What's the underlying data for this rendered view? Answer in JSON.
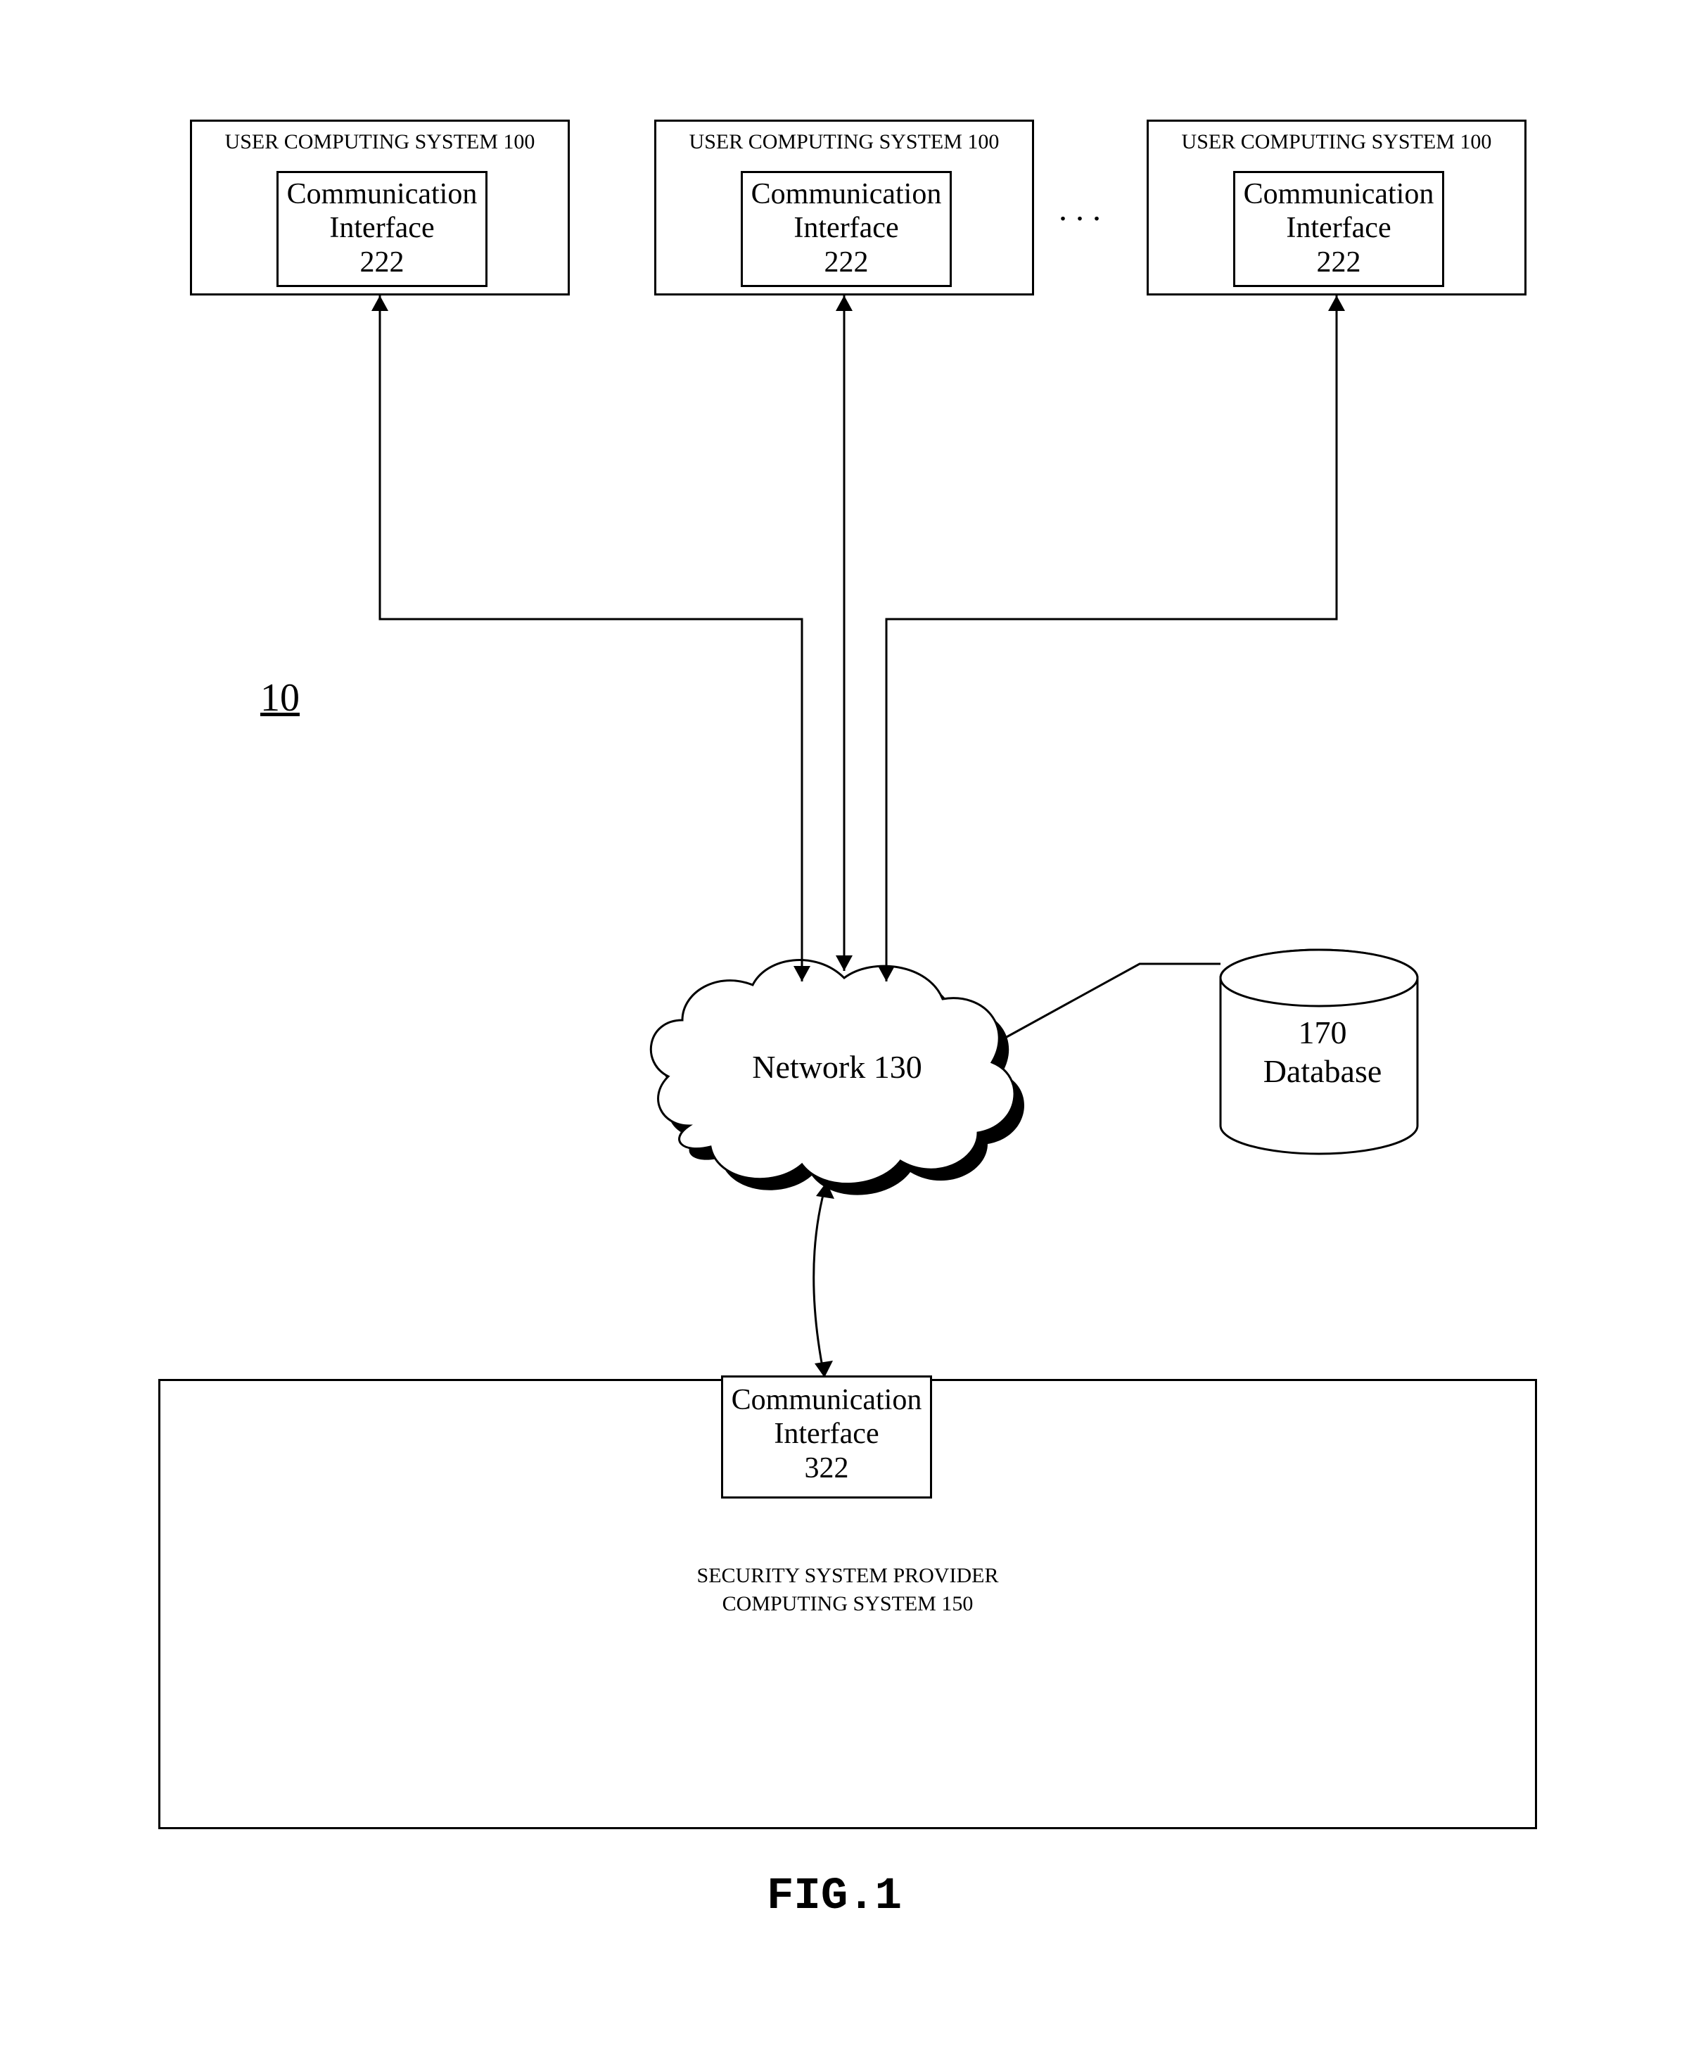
{
  "figure_ref": "10",
  "figure_caption": "FIG.1",
  "ellipsis": ". . .",
  "user_systems": {
    "title": "USER COMPUTING SYSTEM 100",
    "comm_interface": {
      "line1": "Communication",
      "line2": "Interface",
      "number": "222"
    }
  },
  "network": {
    "label": "Network 130"
  },
  "database": {
    "number": "170",
    "label": "Database"
  },
  "provider": {
    "title_line1": "SECURITY SYSTEM PROVIDER",
    "title_line2": "COMPUTING SYSTEM 150",
    "comm_interface": {
      "line1": "Communication",
      "line2": "Interface",
      "number": "322"
    }
  }
}
